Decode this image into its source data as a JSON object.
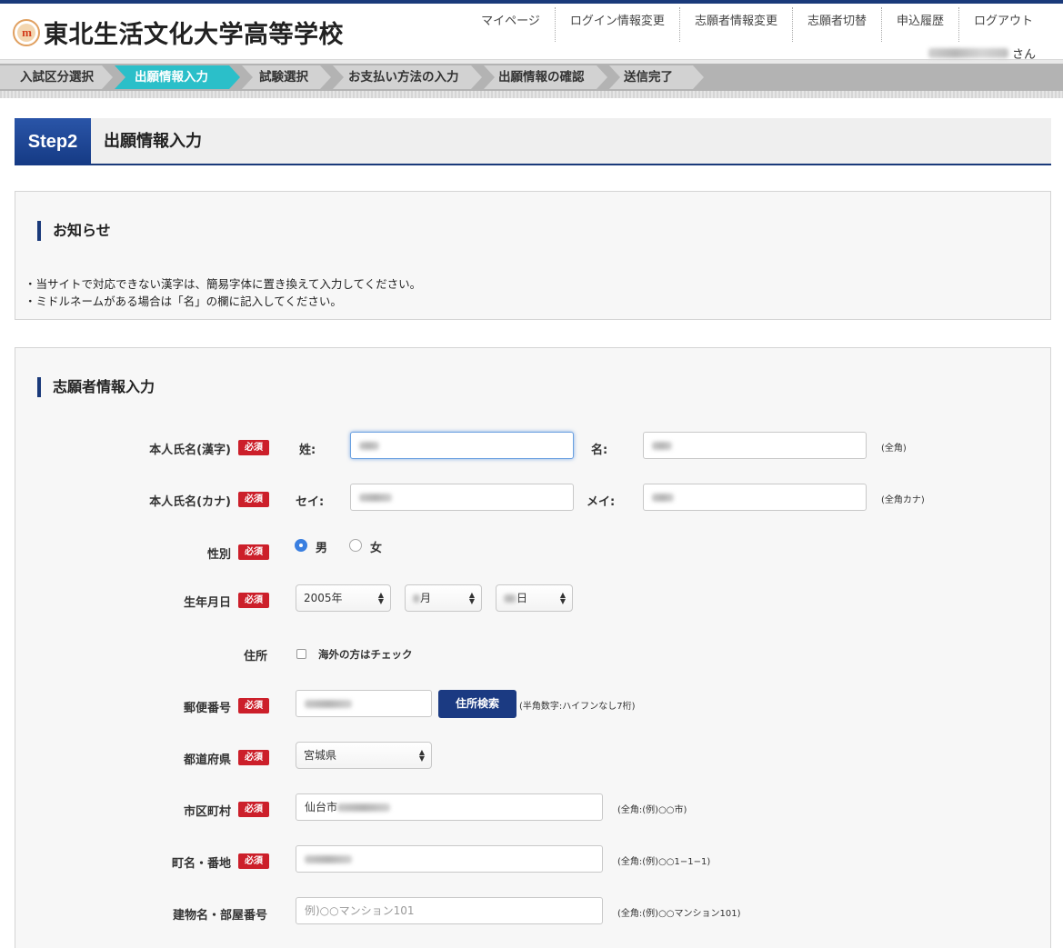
{
  "header": {
    "logo_mark": "m",
    "school_name": "東北生活文化大学高等学校",
    "nav": [
      "マイページ",
      "ログイン情報変更",
      "志願者情報変更",
      "志願者切替",
      "申込履歴",
      "ログアウト"
    ],
    "user_suffix": "さん"
  },
  "steps": {
    "items": [
      "入試区分選択",
      "出願情報入力",
      "試験選択",
      "お支払い方法の入力",
      "出願情報の確認",
      "送信完了"
    ],
    "active_index": 1,
    "colors": {
      "active": "#2bbfc9",
      "inactive": "#d2d2d2",
      "bar": "#b3b3b3"
    }
  },
  "page": {
    "step_badge": "Step2",
    "step_heading": "出願情報入力"
  },
  "notice": {
    "title": "お知らせ",
    "lines": [
      "・当サイトで対応できない漢字は、簡易字体に置き換えて入力してください。",
      "・ミドルネームがある場合は「名」の欄に記入してください。"
    ]
  },
  "form": {
    "title": "志願者情報入力",
    "required_label": "必須",
    "name_kanji": {
      "label": "本人氏名(漢字)",
      "sei_label": "姓:",
      "mei_label": "名:",
      "hint": "(全角)"
    },
    "name_kana": {
      "label": "本人氏名(カナ)",
      "sei_label": "セイ:",
      "mei_label": "メイ:",
      "hint": "(全角カナ)"
    },
    "gender": {
      "label": "性別",
      "options": [
        "男",
        "女"
      ],
      "selected": "男"
    },
    "birthdate": {
      "label": "生年月日",
      "year": "2005年",
      "month_suffix": "月",
      "day_suffix": "日"
    },
    "address": {
      "label": "住所",
      "overseas_label": "海外の方はチェック",
      "overseas_checked": false
    },
    "postal": {
      "label": "郵便番号",
      "button": "住所検索",
      "hint": "(半角数字:ハイフンなし7桁)"
    },
    "prefecture": {
      "label": "都道府県",
      "value": "宮城県"
    },
    "city": {
      "label": "市区町村",
      "value_prefix": "仙台市",
      "hint": "(全角:(例)○○市)"
    },
    "street": {
      "label": "町名・番地",
      "hint": "(全角:(例)○○1−1−1)"
    },
    "building": {
      "label": "建物名・部屋番号",
      "placeholder": "例)○○マンション101",
      "hint": "(全角:(例)○○マンション101)"
    }
  }
}
